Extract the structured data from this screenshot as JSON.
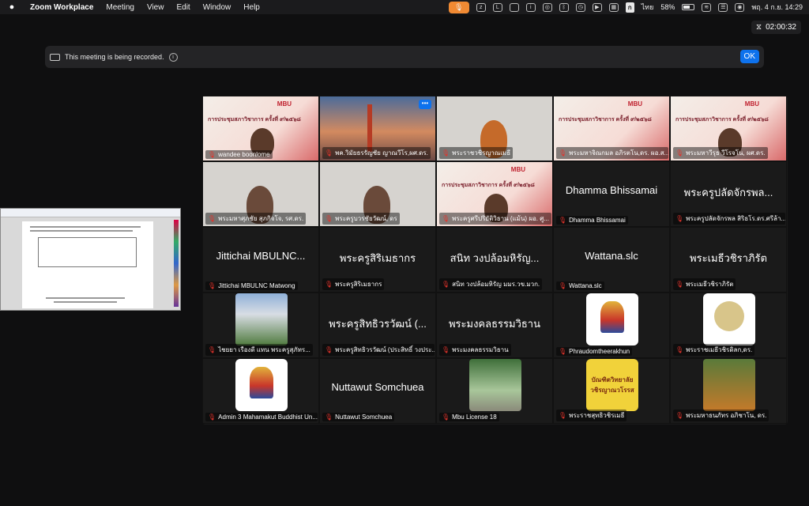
{
  "menubar": {
    "app_name": "Zoom Workplace",
    "menus": [
      "Meeting",
      "View",
      "Edit",
      "Window",
      "Help"
    ],
    "input_lang": "ก",
    "lang_label": "ไทย",
    "battery": "58%",
    "datetime": "พฤ. 4 ก.ย.  14:29"
  },
  "timer": {
    "value": "02:00:32"
  },
  "recording": {
    "text": "This meeting is being recorded.",
    "ok_label": "OK"
  },
  "tiles": [
    {
      "name": "wandee boonlome",
      "type": "slide",
      "slide_title": "การประชุมสภาวิชาการ ครั้งที่ ๙/๒๕๖๘"
    },
    {
      "name": "พค.วิมัยธรรัญชัย ญาณวีโร,ผศ.ดร.",
      "type": "bridge"
    },
    {
      "name": "พระราชวชิรญาณเมธี",
      "type": "office"
    },
    {
      "name": "พระมหาจิณกมล อภิรตโน,ดร. ผอ.ส...",
      "type": "slide",
      "slide_title": "การประชุมสภาวิชาการ ครั้งที่ ๙/๒๕๖๘"
    },
    {
      "name": "พระมหาวีรุธ วีโรจโน, ผศ.ดร.",
      "type": "slide",
      "slide_title": "การประชุมสภาวิชาการ ครั้งที่ ๙/๒๕๖๘"
    },
    {
      "name": "พระมหาศุภชัย สุภกิจโจ, รศ.ดร.",
      "type": "office"
    },
    {
      "name": "พระครูบวรชัยวัฒน์, ดร",
      "type": "office"
    },
    {
      "name": "พระครูศรีปริยัติวิธาน (แม้น) ผอ. ศู...",
      "type": "slide",
      "slide_title": "การประชุมสภาวิชาการ ครั้งที่ ๙/๒๕๖๘"
    },
    {
      "name": "Dhamma Bhissamai",
      "type": "text",
      "big": "Dhamma Bhissamai"
    },
    {
      "name": "พระครูปลัดจักรพล สิริธโร.ดร.ศรีล้า...",
      "type": "text",
      "big": "พระครูปลัดจักรพล..."
    },
    {
      "name": "Jittichai MBULNC Matwong",
      "type": "text",
      "big": "Jittichai MBULNC..."
    },
    {
      "name": "พระครูสิริเมธากร",
      "type": "text",
      "big": "พระครูสิริเมธากร"
    },
    {
      "name": "สนิท วงปล้อมหิรัญ มมร.วข.มวก.",
      "type": "text",
      "big": "สนิท วงปล้อมหิรัญ..."
    },
    {
      "name": "Wattana.slc",
      "type": "text",
      "big": "Wattana.slc"
    },
    {
      "name": "พระเมธีวชิราภิรัต",
      "type": "text",
      "big": "พระเมธีวชิราภิรัต"
    },
    {
      "name": "ไชยยา เรืองดี แทน พระครูสุภัทร...",
      "type": "photo"
    },
    {
      "name": "พระครูสิทธิวรวัฒน์ (ประสิทธิ์ วงประ...",
      "type": "text",
      "big": "พระครูสิทธิวรวัฒน์ (..."
    },
    {
      "name": "พระมงคลธรรมวิธาน",
      "type": "text",
      "big": "พระมงคลธรรมวิธาน"
    },
    {
      "name": "Phraudomtheerakhun",
      "type": "logo"
    },
    {
      "name": "พระราชเมธีวชิรดิลก,ดร.",
      "type": "logo2"
    },
    {
      "name": "Admin 3 Mahamakut Buddhist Un...",
      "type": "logo"
    },
    {
      "name": "Nuttawut Somchuea",
      "type": "text",
      "big": "Nuttawut Somchuea"
    },
    {
      "name": "Mbu License 18",
      "type": "photo2"
    },
    {
      "name": "พระราชสุทธิวชิรเมธี",
      "type": "logo3",
      "logo_text": "บัณฑิตวิทยาลัย วชิรญาณวโรรส"
    },
    {
      "name": "พระมหาธนภัทร อภิชาโน, ดร.",
      "type": "photo3"
    }
  ],
  "colors": {
    "accent": "#0e72ed",
    "mute": "#e3332b",
    "mic_active": "#f08a33"
  }
}
